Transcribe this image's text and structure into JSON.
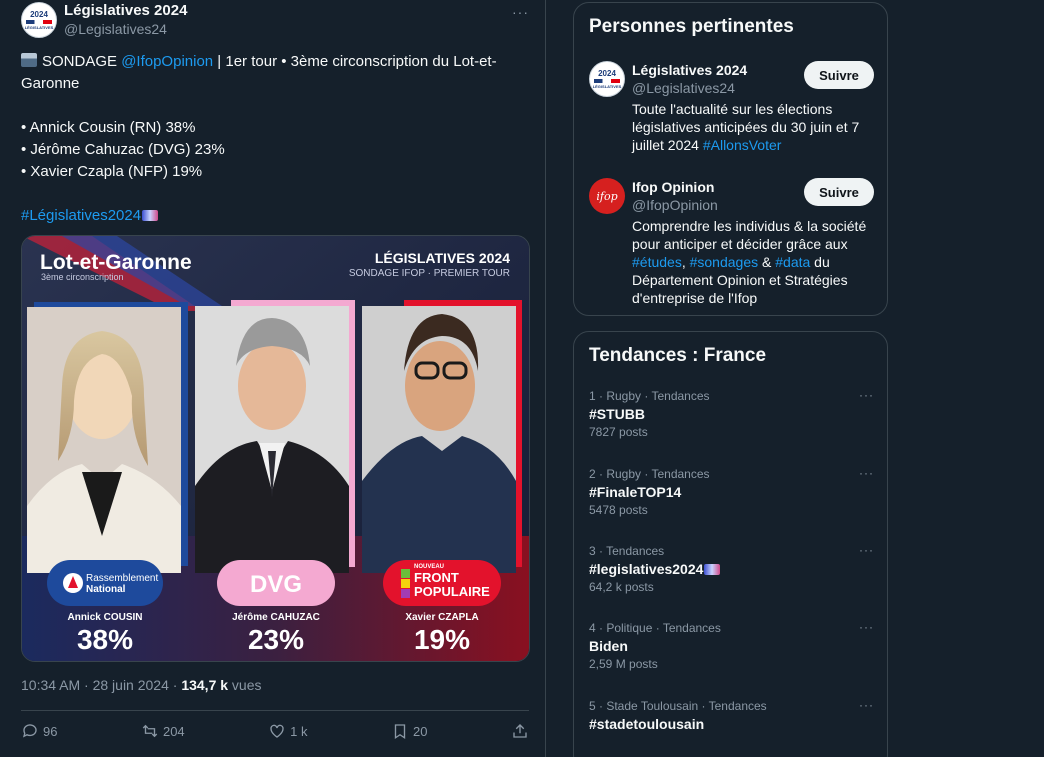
{
  "tweet": {
    "author_avatar_text": "2024",
    "author_avatar_sub": "LÉGISLATIVES",
    "display_name": "Législatives 2024",
    "handle": "@Legislatives24",
    "more": "···",
    "line1_prefix": "SONDAGE ",
    "line1_mention": "@IfopOpinion",
    "line1_rest": " | 1er tour • 3ème circonscription du Lot-et-Garonne",
    "bullets": [
      "• Annick Cousin (RN) 38%",
      "• Jérôme Cahuzac (DVG) 23%",
      "• Xavier Czapla (NFP) 19%"
    ],
    "hashtag": "#Législatives2024",
    "time": "10:34 AM · 28 juin 2024 · ",
    "views_count": "134,7 k",
    "views_label": " vues",
    "actions": {
      "replies": "96",
      "retweets": "204",
      "likes": "1 k",
      "bookmarks": "20"
    }
  },
  "poster": {
    "title": "Lot-et-Garonne",
    "subtitle": "3ème circonscription",
    "head_title": "LÉGISLATIVES 2024",
    "head_sub": "SONDAGE IFOP · PREMIER TOUR",
    "candidates": [
      {
        "party_line1": "Rassemblement",
        "party_line2": "National",
        "name": "Annick COUSIN",
        "pct": "38%",
        "accent": "#1e4a9c"
      },
      {
        "party_line1": "DVG",
        "party_line2": "",
        "name": "Jérôme CAHUZAC",
        "pct": "23%",
        "accent": "#f4a9d1"
      },
      {
        "party_line1": "FRONT",
        "party_line2": "POPULAIRE",
        "party_line0": "NOUVEAU",
        "name": "Xavier CZAPLA",
        "pct": "19%",
        "accent": "#e3122c"
      }
    ]
  },
  "who": {
    "title": "Personnes pertinentes",
    "people": [
      {
        "name": "Législatives 2024",
        "handle": "@Legislatives24",
        "follow": "Suivre",
        "bio": "Toute l'actualité sur les élections législatives anticipées du 30 juin et 7 juillet 2024 ",
        "bio_tag": "#AllonsVoter"
      },
      {
        "name": "Ifop Opinion",
        "handle": "@IfopOpinion",
        "follow": "Suivre",
        "avatar_text": "ifop",
        "bio_1": "Comprendre les individus & la société pour anticiper et décider grâce aux ",
        "bio_tag1": "#études",
        "bio_2": ", ",
        "bio_tag2": "#sondages",
        "bio_3": " & ",
        "bio_tag3": "#data",
        "bio_4": " du Département Opinion et Stratégies d'entreprise de l'Ifop"
      }
    ]
  },
  "trends": {
    "title": "Tendances : France",
    "items": [
      {
        "context": "1 · Rugby · Tendances",
        "tag": "#STUBB",
        "count": "7827 posts"
      },
      {
        "context": "2 · Rugby · Tendances",
        "tag": "#FinaleTOP14",
        "count": "5478 posts"
      },
      {
        "context": "3 · Tendances",
        "tag": "#legislatives2024",
        "count": "64,2 k posts"
      },
      {
        "context": "4 · Politique · Tendances",
        "tag": "Biden",
        "count": "2,59 M posts"
      },
      {
        "context": "5 · Stade Toulousain · Tendances",
        "tag": "#stadetoulousain",
        "count": ""
      }
    ]
  }
}
